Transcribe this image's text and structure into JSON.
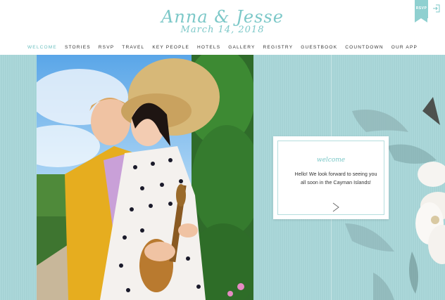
{
  "header": {
    "names": "Anna & Jesse",
    "date": "March 14, 2018",
    "rsvp_ribbon": "RSVP",
    "login_icon": "login-icon"
  },
  "nav": {
    "items": [
      {
        "label": "WELCOME",
        "active": true
      },
      {
        "label": "STORIES"
      },
      {
        "label": "RSVP"
      },
      {
        "label": "TRAVEL"
      },
      {
        "label": "KEY PEOPLE"
      },
      {
        "label": "HOTELS"
      },
      {
        "label": "GALLERY"
      },
      {
        "label": "REGISTRY"
      },
      {
        "label": "GUESTBOOK"
      },
      {
        "label": "COUNTDOWN"
      },
      {
        "label": "OUR APP"
      }
    ]
  },
  "welcome": {
    "title": "welcome",
    "message": "Hello! We look forward to seeing you all soon in the Cayman Islands!",
    "next_icon": "chevron-right-icon"
  },
  "colors": {
    "accent": "#7cc8c8",
    "background": "#a9d7d9"
  }
}
